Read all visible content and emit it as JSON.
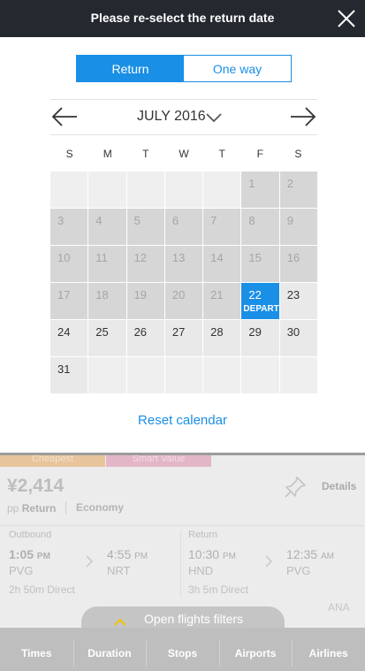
{
  "header": {
    "title": "Please re-select the return date",
    "close_icon": "close-icon"
  },
  "trip_type": {
    "options": [
      "Return",
      "One way"
    ],
    "selected": "Return"
  },
  "calendar": {
    "month_label": "JULY 2016",
    "prev_icon": "arrow-left-icon",
    "next_icon": "arrow-right-icon",
    "dropdown_icon": "chevron-down-icon",
    "weekdays": [
      "S",
      "M",
      "T",
      "W",
      "T",
      "F",
      "S"
    ],
    "cells": [
      {
        "day": ""
      },
      {
        "day": ""
      },
      {
        "day": ""
      },
      {
        "day": ""
      },
      {
        "day": ""
      },
      {
        "day": "1",
        "state": "disabled"
      },
      {
        "day": "2",
        "state": "disabled"
      },
      {
        "day": "3",
        "state": "disabled"
      },
      {
        "day": "4",
        "state": "disabled"
      },
      {
        "day": "5",
        "state": "disabled"
      },
      {
        "day": "6",
        "state": "disabled"
      },
      {
        "day": "7",
        "state": "disabled"
      },
      {
        "day": "8",
        "state": "disabled"
      },
      {
        "day": "9",
        "state": "disabled"
      },
      {
        "day": "10",
        "state": "disabled"
      },
      {
        "day": "11",
        "state": "disabled"
      },
      {
        "day": "12",
        "state": "disabled"
      },
      {
        "day": "13",
        "state": "disabled"
      },
      {
        "day": "14",
        "state": "disabled"
      },
      {
        "day": "15",
        "state": "disabled"
      },
      {
        "day": "16",
        "state": "disabled"
      },
      {
        "day": "17",
        "state": "disabled"
      },
      {
        "day": "18",
        "state": "disabled"
      },
      {
        "day": "19",
        "state": "disabled"
      },
      {
        "day": "20",
        "state": "disabled"
      },
      {
        "day": "21",
        "state": "disabled"
      },
      {
        "day": "22",
        "state": "selected",
        "tag": "DEPART"
      },
      {
        "day": "23",
        "state": "available"
      },
      {
        "day": "24",
        "state": "available"
      },
      {
        "day": "25",
        "state": "available"
      },
      {
        "day": "26",
        "state": "available"
      },
      {
        "day": "27",
        "state": "available"
      },
      {
        "day": "28",
        "state": "available"
      },
      {
        "day": "29",
        "state": "available"
      },
      {
        "day": "30",
        "state": "available"
      },
      {
        "day": "31",
        "state": "available"
      },
      {
        "day": ""
      },
      {
        "day": ""
      },
      {
        "day": ""
      },
      {
        "day": ""
      },
      {
        "day": ""
      },
      {
        "day": ""
      }
    ],
    "reset_label": "Reset calendar"
  },
  "background": {
    "tabs": [
      "Cheapest",
      "Smart Value"
    ],
    "price": "¥2,414",
    "pp": "pp",
    "trip": "Return",
    "cabin": "Economy",
    "pin_icon": "pin-icon",
    "details": "Details",
    "outbound": {
      "label": "Outbound",
      "dep_time": "1:05",
      "dep_ampm": "PM",
      "dep_code": "PVG",
      "arr_time": "4:55",
      "arr_ampm": "PM",
      "arr_code": "NRT",
      "duration": "2h 50m Direct"
    },
    "return": {
      "label": "Return",
      "dep_time": "10:30",
      "dep_ampm": "PM",
      "dep_code": "HND",
      "arr_time": "12:35",
      "arr_ampm": "AM",
      "arr_code": "PVG",
      "duration": "3h 5m Direct"
    },
    "airline": "ANA",
    "filters_label": "Open flights filters",
    "filter_tabs": [
      "Times",
      "Duration",
      "Stops",
      "Airports",
      "Airlines"
    ]
  },
  "colors": {
    "accent": "#1a8fe6",
    "header_bg": "#24292f",
    "disabled_cell": "#d6d6d6",
    "available_cell": "#e9e9e9"
  }
}
